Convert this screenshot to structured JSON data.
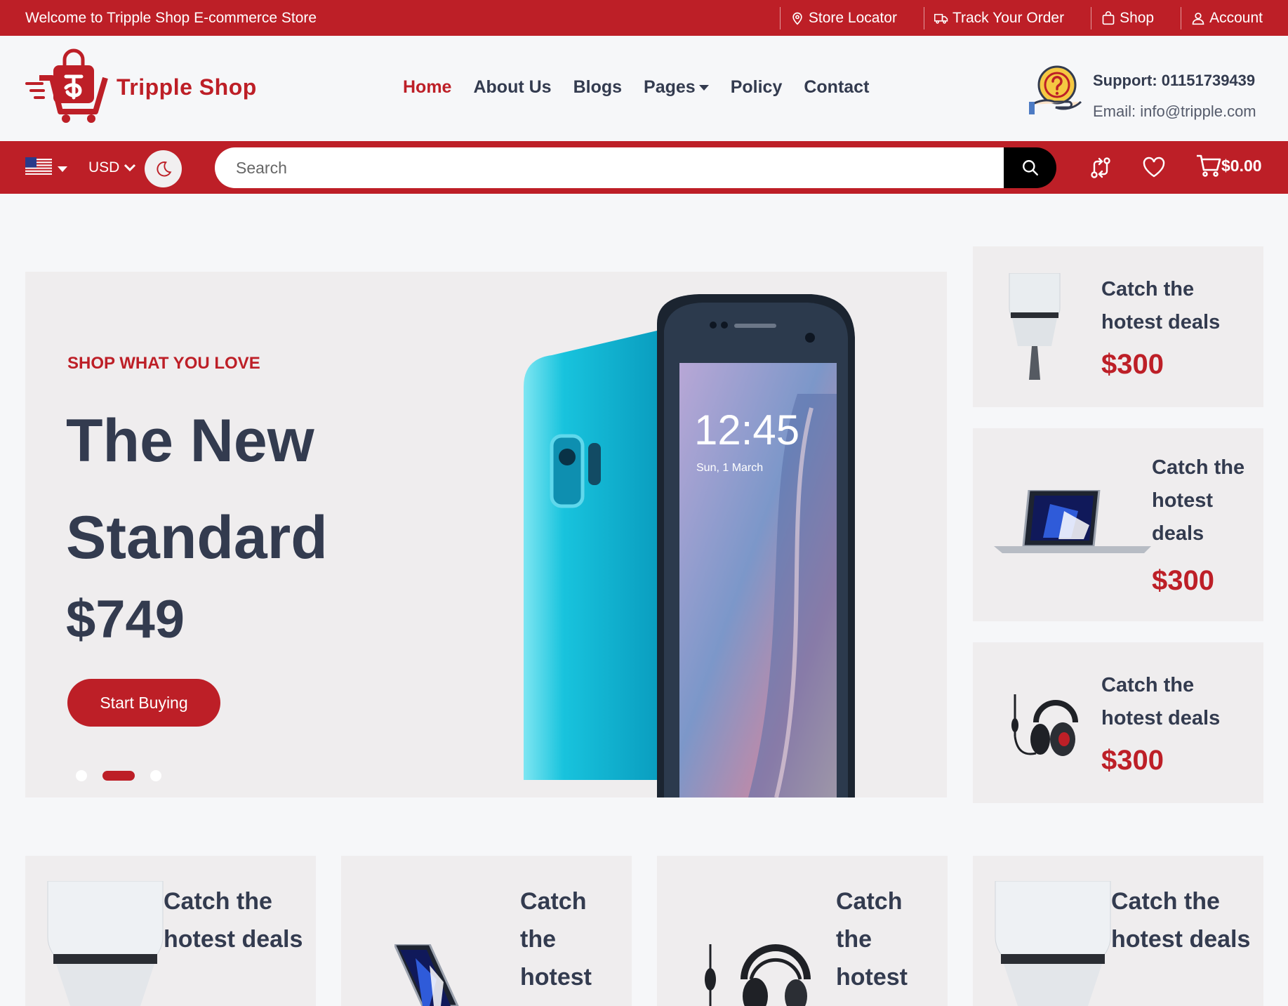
{
  "topbar": {
    "welcome": "Welcome to Tripple Shop E-commerce Store",
    "links": [
      "Store Locator",
      "Track Your Order",
      "Shop",
      "Account"
    ]
  },
  "brand": {
    "name": "Tripple Shop",
    "color": "#bd1f27"
  },
  "nav": {
    "items": [
      "Home",
      "About Us",
      "Blogs",
      "Pages",
      "Policy",
      "Contact"
    ],
    "active": "Home"
  },
  "support": {
    "phone": "Support: 01151739439",
    "email": "Email: info@tripple.com"
  },
  "toolbar": {
    "currency": "USD",
    "search_placeholder": "Search",
    "cart_total": "$0.00"
  },
  "hero": {
    "kicker": "SHOP WHAT YOU LOVE",
    "title": "The New Standard",
    "price": "$749",
    "cta": "Start Buying",
    "phone_time": "12:45",
    "phone_date": "Sun, 1 March",
    "active_slide": 2,
    "slide_count": 3
  },
  "side_deals": [
    {
      "title": "Catch the hotest deals",
      "price": "$300",
      "product": "speaker"
    },
    {
      "title": "Catch the hotest deals",
      "price": "$300",
      "product": "laptop"
    },
    {
      "title": "Catch the hotest deals",
      "price": "$300",
      "product": "headphones"
    }
  ],
  "bottom_cards": [
    {
      "title": "Catch the hotest deals",
      "product": "speaker"
    },
    {
      "title": "Catch the hotest",
      "product": "laptop"
    },
    {
      "title": "Catch the hotest",
      "product": "headphones"
    },
    {
      "title": "Catch the hotest deals",
      "product": "speaker"
    }
  ]
}
